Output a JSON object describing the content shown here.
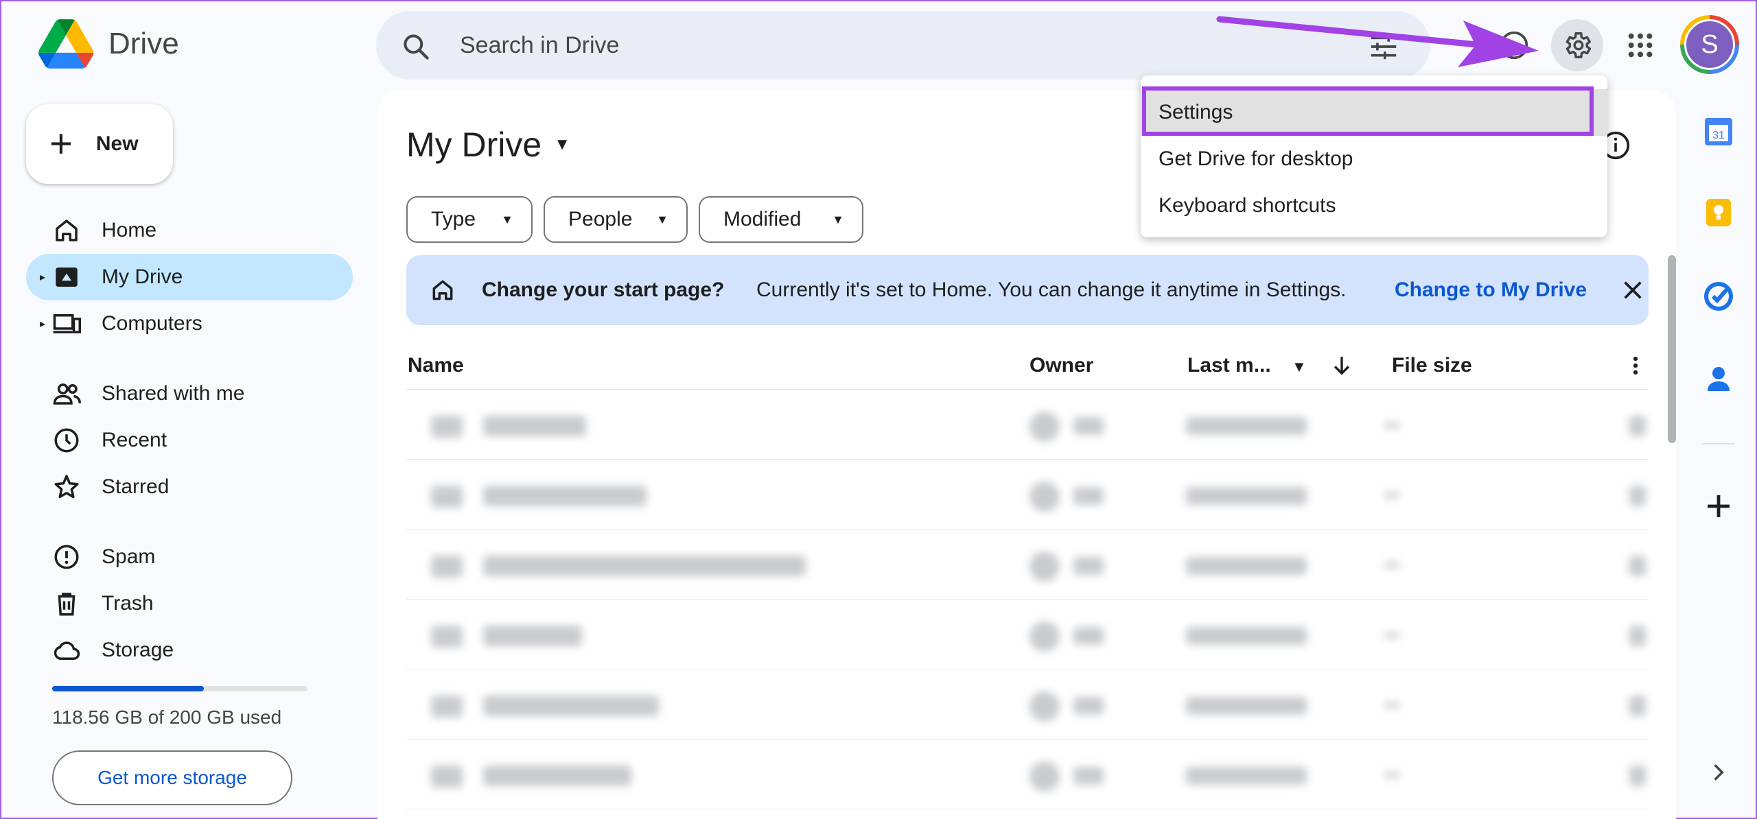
{
  "app": {
    "name": "Drive"
  },
  "search": {
    "placeholder": "Search in Drive"
  },
  "user": {
    "avatar_letter": "S"
  },
  "sidebar": {
    "new_label": "New",
    "items": [
      {
        "label": "Home",
        "icon": "home-icon"
      },
      {
        "label": "My Drive",
        "icon": "my-drive-icon",
        "active": true
      },
      {
        "label": "Computers",
        "icon": "computers-icon"
      },
      {
        "label": "Shared with me",
        "icon": "shared-icon"
      },
      {
        "label": "Recent",
        "icon": "clock-icon"
      },
      {
        "label": "Starred",
        "icon": "star-icon"
      },
      {
        "label": "Spam",
        "icon": "spam-icon"
      },
      {
        "label": "Trash",
        "icon": "trash-icon"
      },
      {
        "label": "Storage",
        "icon": "cloud-icon"
      }
    ],
    "storage": {
      "used_text": "118.56 GB of 200 GB used",
      "used_fraction": 0.593
    },
    "more_storage_label": "Get more storage"
  },
  "main": {
    "title": "My Drive",
    "filters": [
      "Type",
      "People",
      "Modified"
    ],
    "banner": {
      "bold": "Change your start page?",
      "text": "Currently it's set to Home. You can change it anytime in Settings.",
      "link": "Change to My Drive"
    },
    "columns": {
      "name": "Name",
      "owner": "Owner",
      "last_modified": "Last m...",
      "file_size": "File size"
    }
  },
  "settings_menu": {
    "items": [
      "Settings",
      "Get Drive for desktop",
      "Keyboard shortcuts"
    ],
    "highlighted": "Settings"
  },
  "colors": {
    "accent": "#0b57d0",
    "active_nav": "#c2e7ff",
    "banner": "#d3e3fd",
    "highlight_box": "#a142e5"
  }
}
